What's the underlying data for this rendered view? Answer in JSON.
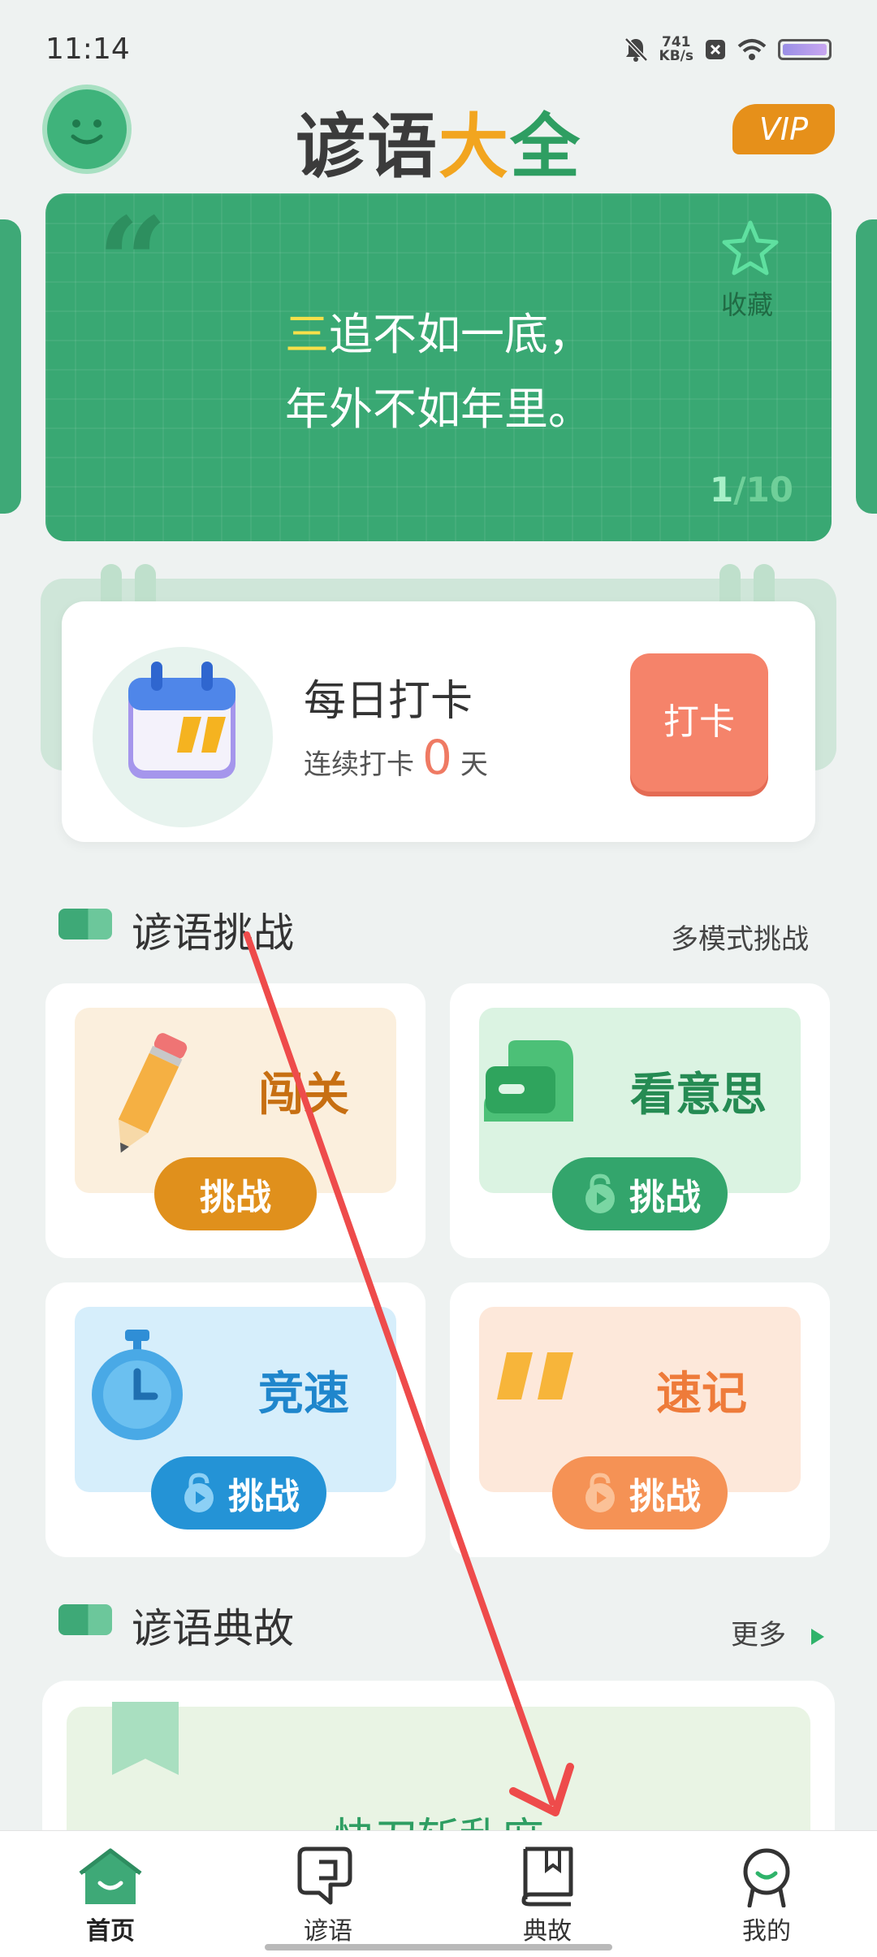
{
  "status_bar": {
    "time": "11:14",
    "net_speed_value": "741",
    "net_speed_unit": "KB/s",
    "icons": [
      "mute-bell-icon",
      "close-box-icon",
      "wifi-icon",
      "battery-icon"
    ]
  },
  "header": {
    "title_parts": [
      "谚语",
      "大",
      "全"
    ],
    "vip_label": "VIP",
    "colors": {
      "title_dark": "#3b3b3b",
      "title_accent": "#f2a51f",
      "title_green": "#2e9e62"
    }
  },
  "proverb_card": {
    "line1_highlight": "三",
    "line1_rest": "追不如一底，",
    "line2": "年外不如年里。",
    "favorite_label": "收藏",
    "page_current": "1",
    "page_total": "/10",
    "color": "#39a873"
  },
  "checkin": {
    "title": "每日打卡",
    "streak_prefix": "连续打卡",
    "streak_days": "0",
    "streak_suffix": "天",
    "button_label": "打卡"
  },
  "challenge_section": {
    "title": "谚语挑战",
    "more_label": "多模式挑战",
    "tiles": [
      {
        "label": "闯关",
        "button": "挑战",
        "color": "#e0901c"
      },
      {
        "label": "看意思",
        "button": "挑战",
        "color": "#33a56c"
      },
      {
        "label": "竞速",
        "button": "挑战",
        "color": "#2493d6"
      },
      {
        "label": "速记",
        "button": "挑战",
        "color": "#f59255"
      }
    ]
  },
  "story_section": {
    "title": "谚语典故",
    "more_label": "更多",
    "first_story": "快刀斩乱麻"
  },
  "bottom_nav": {
    "items": [
      {
        "label": "首页",
        "icon": "home-icon",
        "active": true
      },
      {
        "label": "谚语",
        "icon": "proverb-icon",
        "active": false
      },
      {
        "label": "典故",
        "icon": "book-icon",
        "active": false
      },
      {
        "label": "我的",
        "icon": "profile-icon",
        "active": false
      }
    ]
  }
}
